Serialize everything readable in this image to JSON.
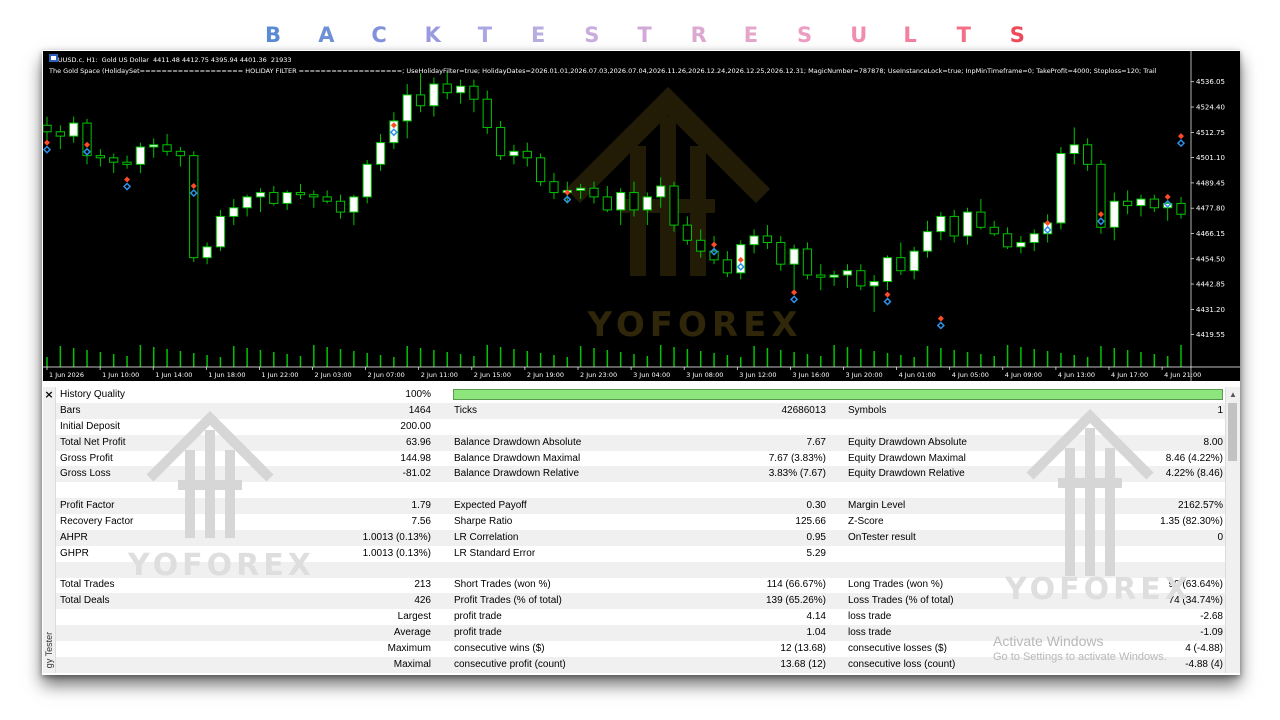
{
  "title": {
    "letters": [
      {
        "ch": "B",
        "color": "#5b8bd0"
      },
      {
        "ch": "A",
        "color": "#6f8fd6"
      },
      {
        "ch": "C",
        "color": "#8292da"
      },
      {
        "ch": "K",
        "color": "#9a9ae0"
      },
      {
        "ch": "T",
        "color": "#aaa7e2"
      },
      {
        "ch": "E",
        "color": "#b9ace0"
      },
      {
        "ch": "S",
        "color": "#c8addf"
      },
      {
        "ch": "T",
        "color": "#d2a8d9"
      },
      {
        "ch": "R",
        "color": "#dba9d2"
      },
      {
        "ch": "E",
        "color": "#e4a7c9"
      },
      {
        "ch": "S",
        "color": "#ec9ec2"
      },
      {
        "ch": "U",
        "color": "#f08eaf"
      },
      {
        "ch": "L",
        "color": "#f2809e"
      },
      {
        "ch": "T",
        "color": "#f2708a"
      },
      {
        "ch": "S",
        "color": "#ee4a5c"
      }
    ]
  },
  "chart": {
    "symbol": "XAUUSD.c, H1:",
    "description": "Gold US Dollar",
    "ohlc": "4411.48 4412.75 4395.94 4401.36",
    "volume": "21933",
    "ea_params": "The Gold Space (HolidaySet=================== HOLIDAY FILTER ===================; UseHolidayFilter=true; HolidayDates=2026.01.01,2026.07.03,2026.07.04,2026.11.26,2026.12.24,2026.12.25,2026.12.31; MagicNumber=787878; UseInstanceLock=true; InpMinTimeframe=0; TakeProfit=4000; Stoploss=120; Trail",
    "price_min": 4412,
    "price_max": 4541,
    "price_levels": [
      "4536.05",
      "4524.40",
      "4512.75",
      "4501.10",
      "4489.45",
      "4477.80",
      "4466.15",
      "4454.50",
      "4442.85",
      "4431.20",
      "4419.55"
    ],
    "time_labels": [
      "1 Jun 2026",
      "1 Jun 10:00",
      "1 Jun 14:00",
      "1 Jun 18:00",
      "1 Jun 22:00",
      "2 Jun 03:00",
      "2 Jun 07:00",
      "2 Jun 11:00",
      "2 Jun 15:00",
      "2 Jun 19:00",
      "2 Jun 23:00",
      "3 Jun 04:00",
      "3 Jun 08:00",
      "3 Jun 12:00",
      "3 Jun 16:00",
      "3 Jun 20:00",
      "4 Jun 01:00",
      "4 Jun 05:00",
      "4 Jun 09:00",
      "4 Jun 13:00",
      "4 Jun 17:00",
      "4 Jun 21:00"
    ],
    "colors": {
      "background": "#000000",
      "bull": "#ffffff",
      "bear": "#000000",
      "wick": "#00c400",
      "volume": "#00c400",
      "text": "#ffffff",
      "buy_marker": "#2f8fe8",
      "sell_marker": "#ff4a2a"
    },
    "watermark_text": "YOFOREX",
    "candles": [
      [
        4516,
        4520,
        4508,
        4513
      ],
      [
        4513,
        4516,
        4505,
        4511
      ],
      [
        4511,
        4520,
        4508,
        4517
      ],
      [
        4517,
        4519,
        4498,
        4502
      ],
      [
        4502,
        4505,
        4497,
        4501
      ],
      [
        4501,
        4503,
        4494,
        4499
      ],
      [
        4499,
        4502,
        4496,
        4498
      ],
      [
        4498,
        4508,
        4494,
        4506
      ],
      [
        4506,
        4510,
        4501,
        4507
      ],
      [
        4507,
        4512,
        4502,
        4504
      ],
      [
        4504,
        4506,
        4497,
        4502
      ],
      [
        4502,
        4504,
        4453,
        4455
      ],
      [
        4455,
        4462,
        4452,
        4460
      ],
      [
        4460,
        4477,
        4458,
        4474
      ],
      [
        4474,
        4482,
        4470,
        4478
      ],
      [
        4478,
        4484,
        4474,
        4483
      ],
      [
        4483,
        4487,
        4476,
        4485
      ],
      [
        4485,
        4488,
        4479,
        4480
      ],
      [
        4480,
        4486,
        4477,
        4485
      ],
      [
        4485,
        4489,
        4482,
        4484
      ],
      [
        4484,
        4486,
        4478,
        4483
      ],
      [
        4483,
        4486,
        4480,
        4481
      ],
      [
        4481,
        4484,
        4473,
        4476
      ],
      [
        4476,
        4484,
        4470,
        4483
      ],
      [
        4483,
        4500,
        4480,
        4498
      ],
      [
        4498,
        4512,
        4495,
        4508
      ],
      [
        4508,
        4522,
        4505,
        4518
      ],
      [
        4518,
        4535,
        4510,
        4530
      ],
      [
        4530,
        4540,
        4522,
        4525
      ],
      [
        4525,
        4538,
        4520,
        4535
      ],
      [
        4535,
        4541,
        4528,
        4531
      ],
      [
        4531,
        4537,
        4526,
        4534
      ],
      [
        4534,
        4537,
        4522,
        4528
      ],
      [
        4528,
        4532,
        4512,
        4515
      ],
      [
        4515,
        4518,
        4500,
        4502
      ],
      [
        4502,
        4507,
        4498,
        4504
      ],
      [
        4504,
        4508,
        4497,
        4501
      ],
      [
        4501,
        4503,
        4488,
        4490
      ],
      [
        4490,
        4494,
        4482,
        4485
      ],
      [
        4485,
        4490,
        4480,
        4486
      ],
      [
        4486,
        4489,
        4482,
        4487
      ],
      [
        4487,
        4490,
        4480,
        4483
      ],
      [
        4483,
        4488,
        4476,
        4477
      ],
      [
        4477,
        4487,
        4470,
        4485
      ],
      [
        4485,
        4490,
        4474,
        4477
      ],
      [
        4477,
        4485,
        4470,
        4483
      ],
      [
        4483,
        4492,
        4478,
        4488
      ],
      [
        4488,
        4490,
        4467,
        4470
      ],
      [
        4470,
        4474,
        4461,
        4463
      ],
      [
        4463,
        4468,
        4455,
        4458
      ],
      [
        4458,
        4465,
        4452,
        4454
      ],
      [
        4454,
        4458,
        4446,
        4448
      ],
      [
        4448,
        4463,
        4445,
        4461
      ],
      [
        4461,
        4468,
        4457,
        4465
      ],
      [
        4465,
        4470,
        4459,
        4462
      ],
      [
        4462,
        4465,
        4449,
        4452
      ],
      [
        4452,
        4461,
        4440,
        4459
      ],
      [
        4459,
        4462,
        4445,
        4447
      ],
      [
        4447,
        4452,
        4440,
        4446
      ],
      [
        4446,
        4449,
        4442,
        4447
      ],
      [
        4447,
        4452,
        4441,
        4449
      ],
      [
        4449,
        4452,
        4440,
        4442
      ],
      [
        4442,
        4447,
        4430,
        4444
      ],
      [
        4444,
        4456,
        4440,
        4455
      ],
      [
        4455,
        4462,
        4447,
        4449
      ],
      [
        4449,
        4460,
        4445,
        4458
      ],
      [
        4458,
        4472,
        4455,
        4467
      ],
      [
        4467,
        4476,
        4463,
        4474
      ],
      [
        4474,
        4477,
        4462,
        4465
      ],
      [
        4465,
        4478,
        4461,
        4476
      ],
      [
        4476,
        4482,
        4468,
        4469
      ],
      [
        4469,
        4472,
        4465,
        4466
      ],
      [
        4466,
        4469,
        4459,
        4460
      ],
      [
        4460,
        4465,
        4457,
        4462
      ],
      [
        4462,
        4468,
        4458,
        4466
      ],
      [
        4466,
        4475,
        4462,
        4471
      ],
      [
        4471,
        4506,
        4468,
        4503
      ],
      [
        4503,
        4515,
        4498,
        4507
      ],
      [
        4507,
        4510,
        4495,
        4498
      ],
      [
        4498,
        4500,
        4466,
        4469
      ],
      [
        4469,
        4485,
        4463,
        4481
      ],
      [
        4481,
        4486,
        4475,
        4479
      ],
      [
        4479,
        4484,
        4474,
        4482
      ],
      [
        4482,
        4484,
        4476,
        4478
      ],
      [
        4478,
        4481,
        4472,
        4480
      ],
      [
        4480,
        4483,
        4473,
        4475
      ]
    ],
    "markers": [
      {
        "i": 0,
        "price": 4508
      },
      {
        "i": 3,
        "price": 4507
      },
      {
        "i": 6,
        "price": 4491
      },
      {
        "i": 11,
        "price": 4488
      },
      {
        "i": 26,
        "price": 4516
      },
      {
        "i": 39,
        "price": 4485
      },
      {
        "i": 50,
        "price": 4461
      },
      {
        "i": 52,
        "price": 4454
      },
      {
        "i": 56,
        "price": 4439
      },
      {
        "i": 63,
        "price": 4438
      },
      {
        "i": 67,
        "price": 4427
      },
      {
        "i": 75,
        "price": 4471
      },
      {
        "i": 79,
        "price": 4475
      },
      {
        "i": 84,
        "price": 4483
      },
      {
        "i": 85,
        "price": 4511
      }
    ]
  },
  "report": {
    "side_label": "gy Tester",
    "history_quality": {
      "label": "History Quality",
      "value": "100%",
      "fill": 1.0
    },
    "rows": [
      {
        "l1": "Bars",
        "v1": "1464",
        "l2": "Ticks",
        "v2": "42686013",
        "l3": "Symbols",
        "v3": "1"
      },
      {
        "l1": "Initial Deposit",
        "v1": "200.00",
        "l2": "",
        "v2": "",
        "l3": "",
        "v3": ""
      },
      {
        "l1": "Total Net Profit",
        "v1": "63.96",
        "l2": "Balance Drawdown Absolute",
        "v2": "7.67",
        "l3": "Equity Drawdown Absolute",
        "v3": "8.00"
      },
      {
        "l1": "Gross Profit",
        "v1": "144.98",
        "l2": "Balance Drawdown Maximal",
        "v2": "7.67 (3.83%)",
        "l3": "Equity Drawdown Maximal",
        "v3": "8.46 (4.22%)"
      },
      {
        "l1": "Gross Loss",
        "v1": "-81.02",
        "l2": "Balance Drawdown Relative",
        "v2": "3.83% (7.67)",
        "l3": "Equity Drawdown Relative",
        "v3": "4.22% (8.46)"
      },
      {
        "l1": "",
        "v1": "",
        "l2": "",
        "v2": "",
        "l3": "",
        "v3": ""
      },
      {
        "l1": "Profit Factor",
        "v1": "1.79",
        "l2": "Expected Payoff",
        "v2": "0.30",
        "l3": "Margin Level",
        "v3": "2162.57%"
      },
      {
        "l1": "Recovery Factor",
        "v1": "7.56",
        "l2": "Sharpe Ratio",
        "v2": "125.66",
        "l3": "Z-Score",
        "v3": "1.35 (82.30%)"
      },
      {
        "l1": "AHPR",
        "v1": "1.0013 (0.13%)",
        "l2": "LR Correlation",
        "v2": "0.95",
        "l3": "OnTester result",
        "v3": "0"
      },
      {
        "l1": "GHPR",
        "v1": "1.0013 (0.13%)",
        "l2": "LR Standard Error",
        "v2": "5.29",
        "l3": "",
        "v3": ""
      },
      {
        "l1": "",
        "v1": "",
        "l2": "",
        "v2": "",
        "l3": "",
        "v3": ""
      },
      {
        "l1": "Total Trades",
        "v1": "213",
        "l2": "Short Trades (won %)",
        "v2": "114 (66.67%)",
        "l3": "Long Trades (won %)",
        "v3": "99 (63.64%)"
      },
      {
        "l1": "Total Deals",
        "v1": "426",
        "l2": "Profit Trades (% of total)",
        "v2": "139 (65.26%)",
        "l3": "Loss Trades (% of total)",
        "v3": "74 (34.74%)"
      },
      {
        "l1": "",
        "v1": "Largest",
        "l2": "profit trade",
        "v2": "4.14",
        "l3": "loss trade",
        "v3": "-2.68"
      },
      {
        "l1": "",
        "v1": "Average",
        "l2": "profit trade",
        "v2": "1.04",
        "l3": "loss trade",
        "v3": "-1.09"
      },
      {
        "l1": "",
        "v1": "Maximum",
        "l2": "consecutive wins ($)",
        "v2": "12 (13.68)",
        "l3": "consecutive losses ($)",
        "v3": "4 (-4.88)"
      },
      {
        "l1": "",
        "v1": "Maximal",
        "l2": "consecutive profit (count)",
        "v2": "13.68 (12)",
        "l3": "consecutive loss (count)",
        "v3": "-4.88 (4)"
      }
    ],
    "watermark_text": "YOFOREX",
    "activate": {
      "line1": "Activate Windows",
      "line2": "Go to Settings to activate Windows."
    }
  }
}
